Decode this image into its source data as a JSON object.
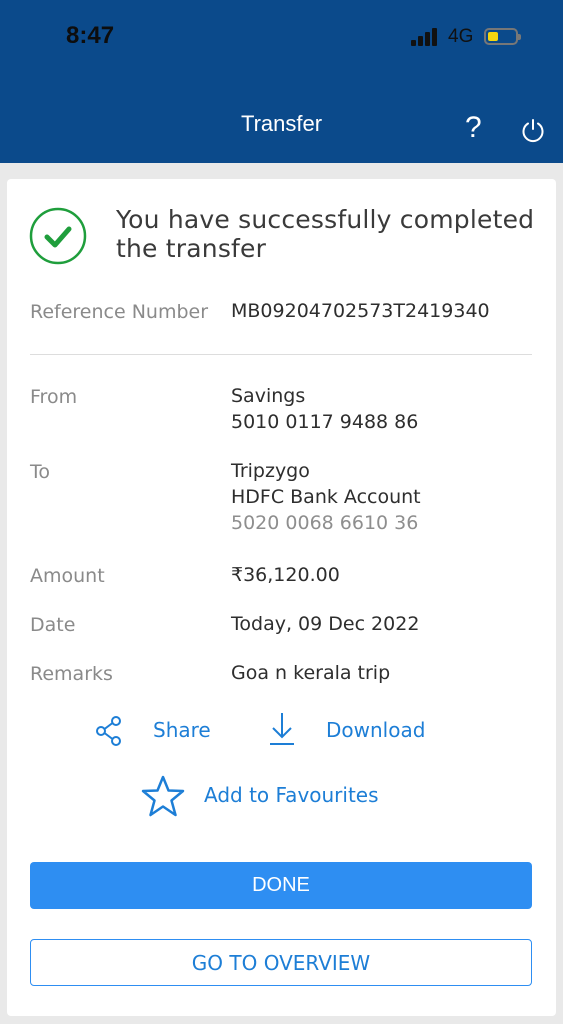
{
  "status_bar": {
    "time": "8:47",
    "network": "4G",
    "battery_level": 0.25
  },
  "nav": {
    "title": "Transfer",
    "help": "?"
  },
  "success_message": "You have successfully completed the transfer",
  "details": {
    "reference": {
      "label": "Reference Number",
      "value": "MB09204702573T2419340"
    },
    "from": {
      "label": "From",
      "account_name": "Savings",
      "account_number": "5010 0117 9488 86"
    },
    "to": {
      "label": "To",
      "payee": "Tripzygo",
      "bank": "HDFC Bank Account",
      "account_number": "5020 0068 6610 36"
    },
    "amount": {
      "label": "Amount",
      "value": "₹36,120.00"
    },
    "date": {
      "label": "Date",
      "value": "Today, 09 Dec 2022"
    },
    "remarks": {
      "label": "Remarks",
      "value": "Goa n kerala trip"
    }
  },
  "actions": {
    "share": "Share",
    "download": "Download",
    "favourites": "Add to Favourites"
  },
  "buttons": {
    "done": "DONE",
    "overview": "GO TO OVERVIEW"
  },
  "colors": {
    "header": "#0b4a8b",
    "accent": "#2e8ef2",
    "success": "#1f9e3c"
  }
}
